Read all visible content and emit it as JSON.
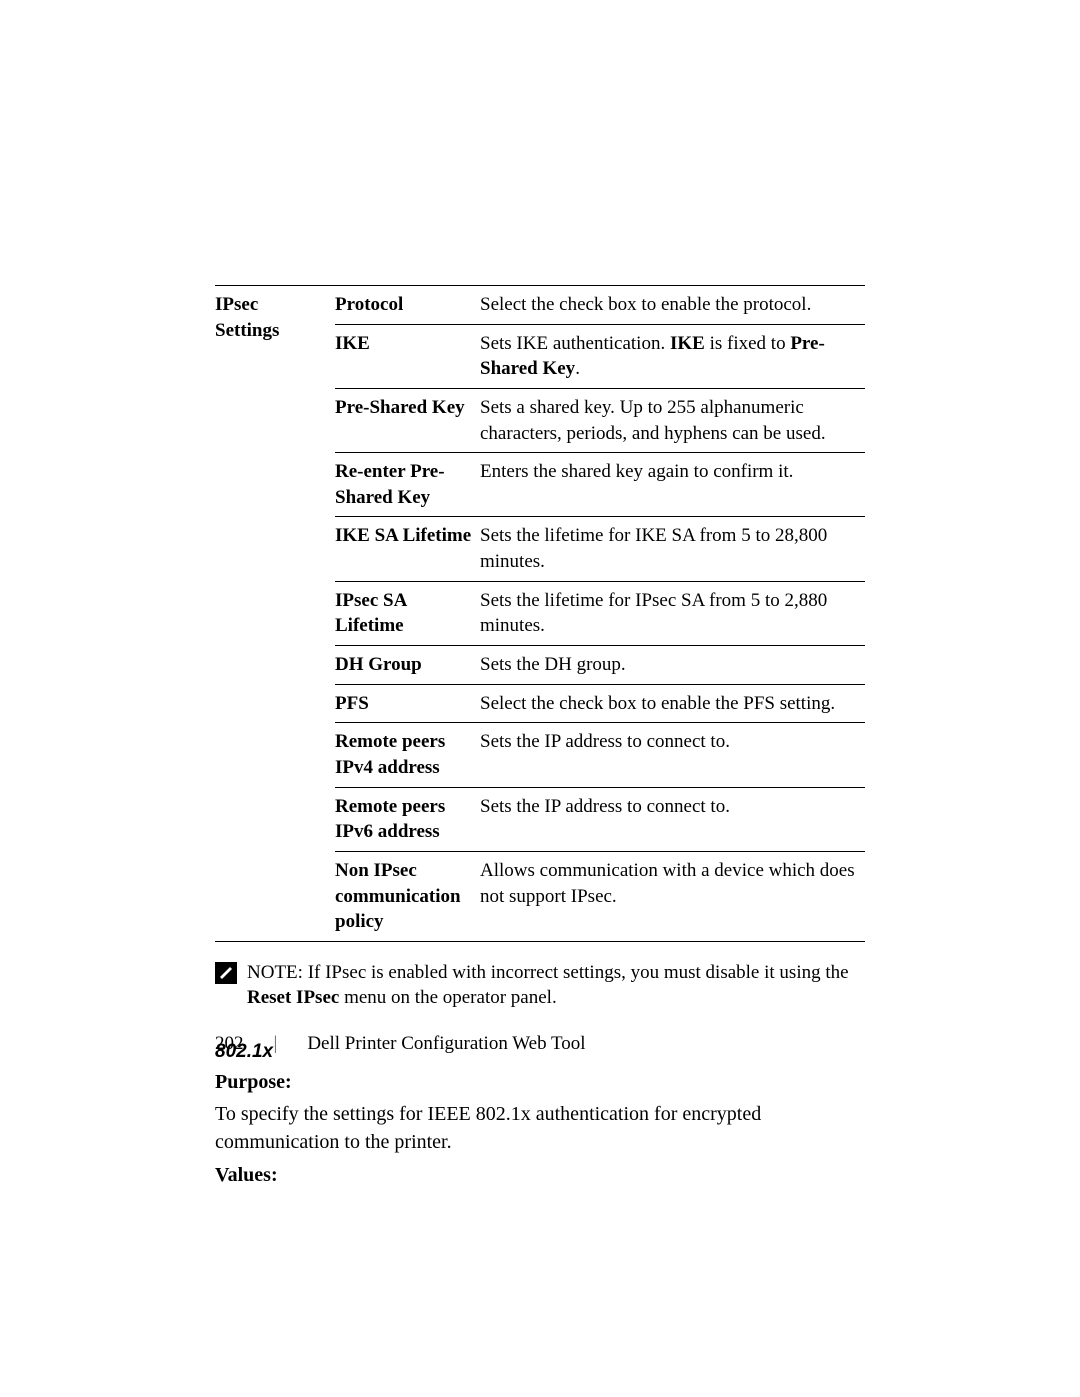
{
  "table": {
    "section_label": "IPsec Settings",
    "rows": [
      {
        "field": "Protocol",
        "desc": "Select the check box to enable the protocol.",
        "bold_parts": []
      },
      {
        "field": "IKE",
        "desc_prefix": "Sets IKE authentication. ",
        "bold1": "IKE",
        "mid": " is fixed to ",
        "bold2": "Pre-Shared Key",
        "suffix": "."
      },
      {
        "field": "Pre-Shared Key",
        "desc": "Sets a shared key. Up to 255 alphanumeric characters, periods, and hyphens can be used."
      },
      {
        "field": "Re-enter Pre-Shared Key",
        "desc": "Enters the shared key again to confirm it."
      },
      {
        "field": "IKE SA Lifetime",
        "desc": "Sets the lifetime for IKE SA from 5 to 28,800 minutes."
      },
      {
        "field": "IPsec SA Lifetime",
        "desc": "Sets the lifetime for IPsec SA from 5 to 2,880 minutes."
      },
      {
        "field": "DH Group",
        "desc": "Sets the DH group."
      },
      {
        "field": "PFS",
        "desc": "Select the check box to enable the PFS setting."
      },
      {
        "field": "Remote peers IPv4 address",
        "desc": "Sets the IP address to connect to."
      },
      {
        "field": "Remote peers IPv6 address",
        "desc": "Sets the IP address to connect to."
      },
      {
        "field": "Non IPsec communication policy",
        "desc": "Allows communication with a device which does not support IPsec."
      }
    ]
  },
  "note": {
    "label": "NOTE:",
    "text_prefix": " If IPsec is enabled with incorrect settings, you must disable it using the ",
    "bold": "Reset IPsec",
    "text_suffix": " menu on the operator panel."
  },
  "section_802": {
    "heading": "802.1x",
    "purpose_label": "Purpose:",
    "purpose_text": "To specify the settings for IEEE 802.1x authentication for encrypted communication to the printer.",
    "values_label": "Values:"
  },
  "footer": {
    "page": "202",
    "title": "Dell Printer Configuration Web Tool"
  }
}
